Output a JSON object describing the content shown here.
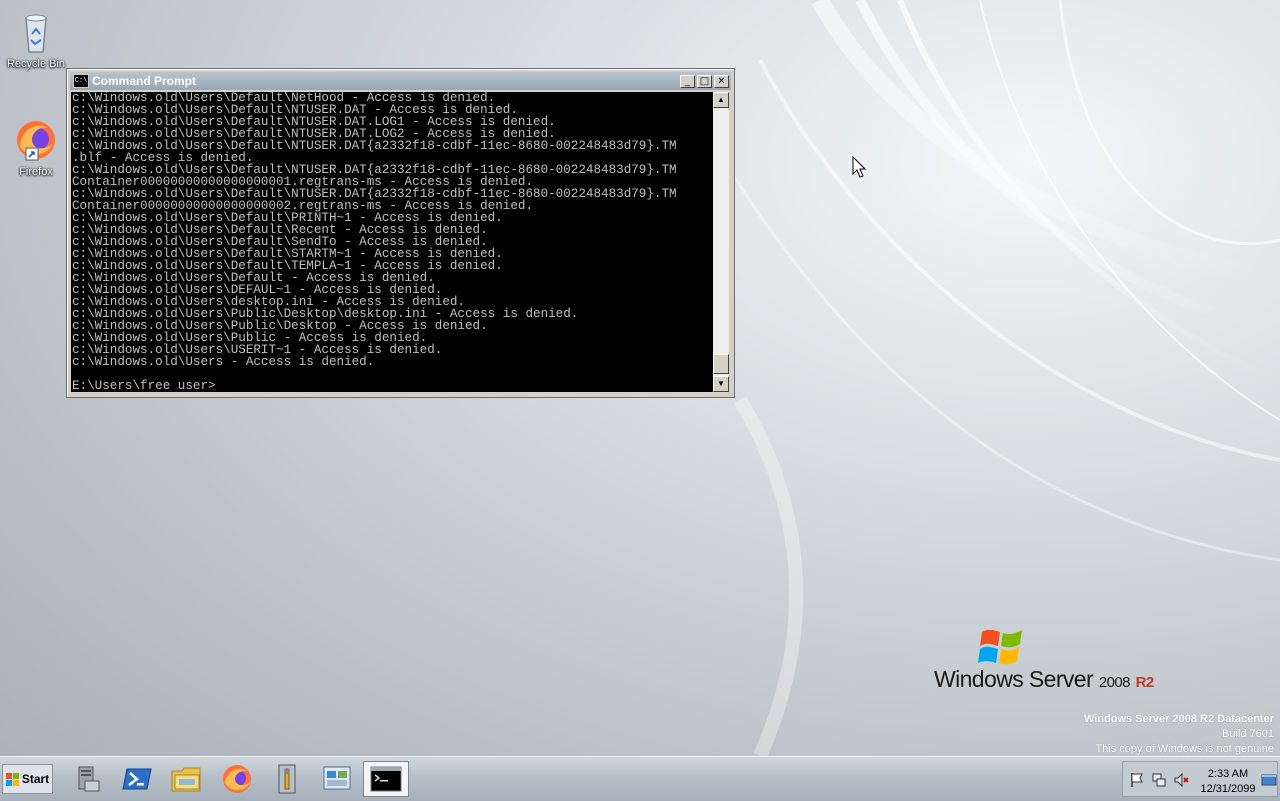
{
  "desktop": {
    "icons": [
      {
        "label": "Recycle Bin",
        "icon": "recycle-bin-icon"
      },
      {
        "label": "Firefox",
        "icon": "firefox-icon"
      }
    ],
    "branding": {
      "product": "Windows Server",
      "year": "2008",
      "release": "R2",
      "edition_line": "Windows Server 2008 R2 Datacenter",
      "build_line": "Build 7601",
      "notice_line": "This copy of Windows is not genuine"
    }
  },
  "cmd_window": {
    "title": "Command Prompt",
    "controls": {
      "minimize": "_",
      "maximize": "□",
      "close": "✕"
    },
    "lines": [
      "c:\\Windows.old\\Users\\Default\\NetHood - Access is denied.",
      "c:\\Windows.old\\Users\\Default\\NTUSER.DAT - Access is denied.",
      "c:\\Windows.old\\Users\\Default\\NTUSER.DAT.LOG1 - Access is denied.",
      "c:\\Windows.old\\Users\\Default\\NTUSER.DAT.LOG2 - Access is denied.",
      "c:\\Windows.old\\Users\\Default\\NTUSER.DAT{a2332f18-cdbf-11ec-8680-002248483d79}.TM",
      ".blf - Access is denied.",
      "c:\\Windows.old\\Users\\Default\\NTUSER.DAT{a2332f18-cdbf-11ec-8680-002248483d79}.TM",
      "Container00000000000000000001.regtrans-ms - Access is denied.",
      "c:\\Windows.old\\Users\\Default\\NTUSER.DAT{a2332f18-cdbf-11ec-8680-002248483d79}.TM",
      "Container00000000000000000002.regtrans-ms - Access is denied.",
      "c:\\Windows.old\\Users\\Default\\PRINTH~1 - Access is denied.",
      "c:\\Windows.old\\Users\\Default\\Recent - Access is denied.",
      "c:\\Windows.old\\Users\\Default\\SendTo - Access is denied.",
      "c:\\Windows.old\\Users\\Default\\STARTM~1 - Access is denied.",
      "c:\\Windows.old\\Users\\Default\\TEMPLA~1 - Access is denied.",
      "c:\\Windows.old\\Users\\Default - Access is denied.",
      "c:\\Windows.old\\Users\\DEFAUL~1 - Access is denied.",
      "c:\\Windows.old\\Users\\desktop.ini - Access is denied.",
      "c:\\Windows.old\\Users\\Public\\Desktop\\desktop.ini - Access is denied.",
      "c:\\Windows.old\\Users\\Public\\Desktop - Access is denied.",
      "c:\\Windows.old\\Users\\Public - Access is denied.",
      "c:\\Windows.old\\Users\\USERIT~1 - Access is denied.",
      "c:\\Windows.old\\Users - Access is denied."
    ],
    "prompt": "E:\\Users\\free user>",
    "scroll_position": 0.95
  },
  "taskbar": {
    "start_label": "Start",
    "apps": [
      {
        "name": "server-manager",
        "icon": "server-manager-icon"
      },
      {
        "name": "powershell",
        "icon": "powershell-icon"
      },
      {
        "name": "windows-explorer",
        "icon": "folder-icon"
      },
      {
        "name": "firefox",
        "icon": "firefox-icon"
      },
      {
        "name": "tools",
        "icon": "tools-icon"
      },
      {
        "name": "control-panel",
        "icon": "control-panel-icon"
      },
      {
        "name": "command-prompt",
        "icon": "cmd-icon",
        "active": true
      }
    ],
    "tray": {
      "time": "2:33 AM",
      "date": "12/31/2099",
      "icons": [
        "action-center-flag-icon",
        "network-icon",
        "volume-muted-icon",
        "show-desktop-icon"
      ]
    }
  },
  "colors": {
    "console_bg": "#000000",
    "console_text": "#c0c0c0",
    "title_bar": "#a8b4c0",
    "r2_accent": "#c23b2a"
  }
}
